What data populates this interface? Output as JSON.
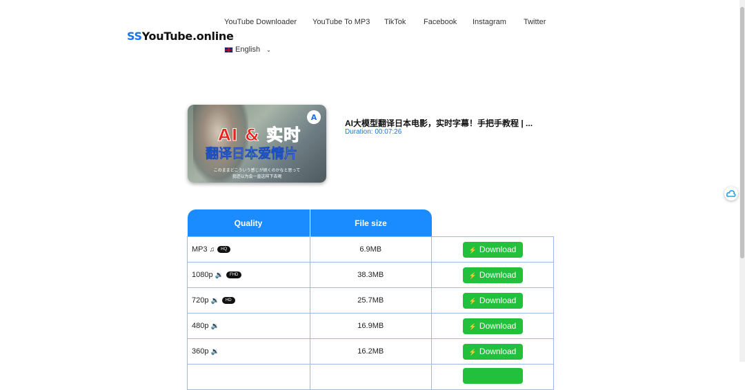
{
  "header": {
    "logo_prefix": "SS",
    "logo_rest": "YouTube.online",
    "nav": [
      {
        "label": "YouTube Downloader"
      },
      {
        "label": "YouTube To MP3"
      },
      {
        "label": "TikTok"
      },
      {
        "label": "Facebook"
      },
      {
        "label": "Instagram"
      },
      {
        "label": "Twitter"
      }
    ],
    "language": "English"
  },
  "video": {
    "thumb_line1": "AI & 实时",
    "thumb_line2": "翻译日本爱情片",
    "thumb_sub1": "このままどこういう感じが続くのかなと思って",
    "thumb_sub2": "我还以为会一直这样下去呢",
    "badge": "A",
    "title": "AI大模型翻译日本电影，实时字幕！手把手教程 | ...",
    "duration": "Duration: 00:07:26"
  },
  "table": {
    "col_quality": "Quality",
    "col_size": "File size",
    "download_label": "Download",
    "rows": [
      {
        "quality": "MP3",
        "icon": "music-note-icon",
        "tag": "HQ",
        "size": "6.9MB"
      },
      {
        "quality": "1080p",
        "icon": "speaker-icon",
        "tag": "FHD",
        "size": "38.3MB"
      },
      {
        "quality": "720p",
        "icon": "speaker-icon",
        "tag": "HD",
        "size": "25.7MB"
      },
      {
        "quality": "480p",
        "icon": "speaker-icon",
        "tag": "",
        "size": "16.9MB"
      },
      {
        "quality": "360p",
        "icon": "speaker-icon",
        "tag": "",
        "size": "16.2MB"
      }
    ]
  },
  "colors": {
    "accent": "#1a8cff",
    "download": "#22c03c"
  }
}
